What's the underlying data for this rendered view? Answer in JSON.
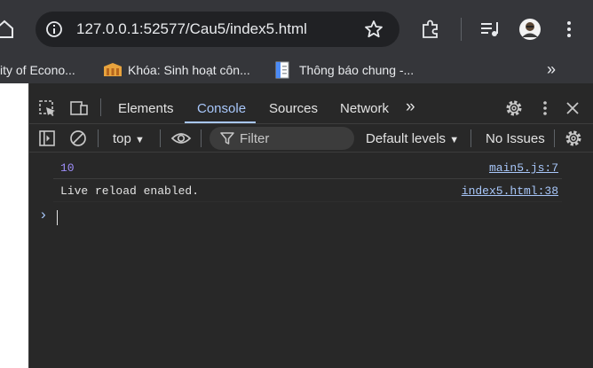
{
  "browser": {
    "address_host": "127.0.0.1",
    "address_path": ":52577/Cau5/index5.html",
    "bookmarks": [
      {
        "label": "ity of Econo..."
      },
      {
        "label": "Khóa: Sinh hoạt côn..."
      },
      {
        "label": "Thông báo chung -..."
      }
    ],
    "bookmarks_overflow": "»"
  },
  "devtools": {
    "tabs": [
      "Elements",
      "Console",
      "Sources",
      "Network"
    ],
    "active_tab": "Console",
    "tabs_overflow": "»",
    "context": "top",
    "filter_placeholder": "Filter",
    "levels": "Default levels",
    "issues": "No Issues"
  },
  "console": {
    "messages": [
      {
        "text": "10",
        "source": "main5.js:7",
        "color": "#9e8ef9"
      },
      {
        "text": "Live reload enabled.",
        "source": "index5.html:38",
        "color": "#e3e3e3"
      }
    ],
    "prompt": "›"
  },
  "colors": {
    "accent": "#a8c7fa",
    "number": "#9e8ef9"
  }
}
